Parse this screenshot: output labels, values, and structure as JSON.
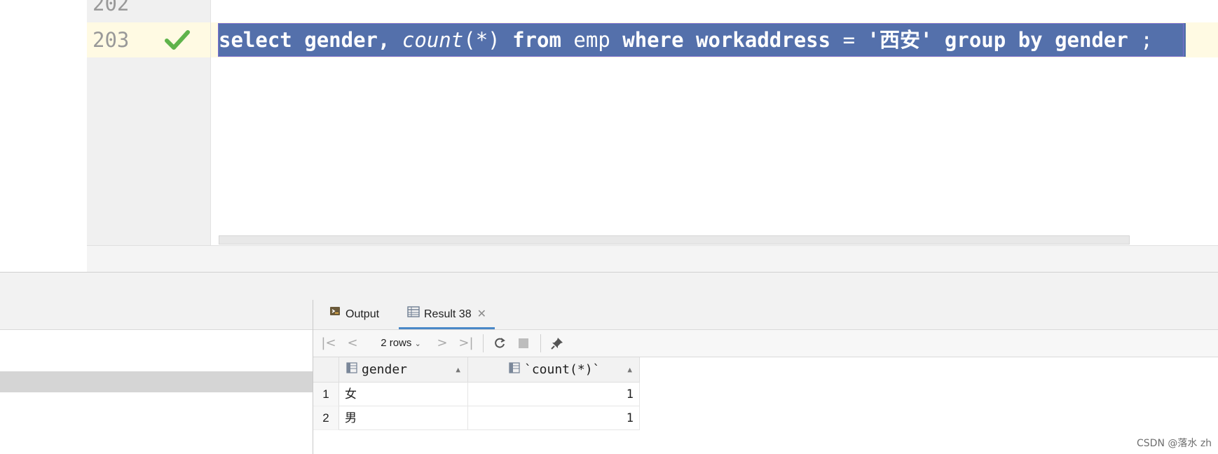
{
  "editor": {
    "lines": [
      {
        "number": "202"
      },
      {
        "number": "203",
        "status": "check-icon"
      }
    ],
    "code": {
      "kw_select": "select",
      "col_gender": "gender,",
      "fn_count": "count",
      "paren_star": "(*)",
      "kw_from": "from",
      "table": "emp",
      "kw_where": "where",
      "col_workaddress": "workaddress",
      "op_eq": "=",
      "str_value": "'西安'",
      "kw_group": "group",
      "kw_by": "by",
      "col_gender2": "gender",
      "semicolon": ";"
    }
  },
  "results_panel": {
    "tabs": [
      {
        "label": "Output",
        "icon": "output-icon"
      },
      {
        "label": "Result 38",
        "icon": "table-icon",
        "closable": true,
        "active": true
      }
    ],
    "toolbar": {
      "rows_label": "2 rows",
      "buttons": [
        "first-page-icon",
        "prev-page-icon",
        "next-page-icon",
        "last-page-icon",
        "refresh-icon",
        "stop-icon",
        "pin-icon"
      ]
    },
    "grid": {
      "columns": [
        "gender",
        "`count(*)`"
      ],
      "rows": [
        {
          "num": "1",
          "gender": "女",
          "count": "1"
        },
        {
          "num": "2",
          "gender": "男",
          "count": "1"
        }
      ]
    }
  },
  "watermark": "CSDN @落水 zh",
  "colors": {
    "selection": "#5470ab",
    "current_line": "#fffae3",
    "check": "#5fb34a",
    "active_tab": "#4a88c7"
  }
}
